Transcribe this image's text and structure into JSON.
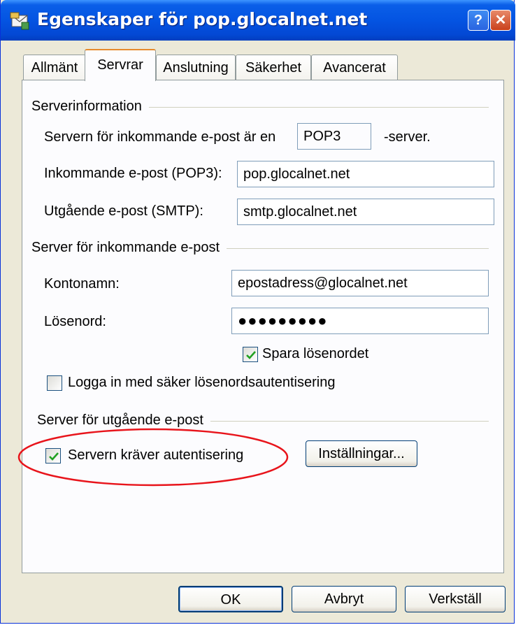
{
  "window": {
    "title": "Egenskaper för pop.glocalnet.net",
    "help_label": "?",
    "close_label": "✕"
  },
  "tabs": [
    {
      "label": "Allmänt"
    },
    {
      "label": "Servrar",
      "active": true
    },
    {
      "label": "Anslutning"
    },
    {
      "label": "Säkerhet"
    },
    {
      "label": "Avancerat"
    }
  ],
  "serverinfo": {
    "group_label": "Serverinformation",
    "incoming_type_prefix": "Servern för inkommande e-post är en",
    "incoming_type_value": "POP3",
    "incoming_type_suffix": "-server.",
    "incoming_label": "Inkommande e-post (POP3):",
    "incoming_value": "pop.glocalnet.net",
    "outgoing_label": "Utgående e-post (SMTP):",
    "outgoing_value": "smtp.glocalnet.net"
  },
  "incoming_server": {
    "group_label": "Server för inkommande e-post",
    "account_label": "Kontonamn:",
    "account_value": "epostadress@glocalnet.net",
    "password_label": "Lösenord:",
    "password_value": "●●●●●●●●●",
    "save_password_label": "Spara lösenordet",
    "save_password_checked": true,
    "spa_label": "Logga in med säker lösenordsautentisering",
    "spa_checked": false
  },
  "outgoing_server": {
    "group_label": "Server för utgående e-post",
    "auth_label": "Servern kräver autentisering",
    "auth_checked": true,
    "settings_button": "Inställningar..."
  },
  "buttons": {
    "ok": "OK",
    "cancel": "Avbryt",
    "apply": "Verkställ"
  },
  "colors": {
    "titlebar": "#0454e2",
    "annotation_ellipse": "#e8141b",
    "checkmark": "#21a121"
  },
  "icons": {
    "app": "mail-properties-icon"
  }
}
